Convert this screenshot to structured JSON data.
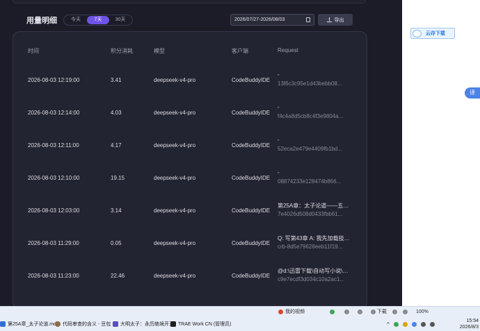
{
  "header": {
    "title": "用量明细",
    "tabs": [
      "今天",
      "7天",
      "30天"
    ],
    "active_tab": "7天"
  },
  "date_range": "2026/07/27-2026/08/03",
  "export_label": "导出",
  "table": {
    "columns": [
      "时间",
      "积分消耗",
      "模型",
      "客户端",
      "Request"
    ],
    "rows": [
      {
        "time": "2026-08-03 12:19:00",
        "credits": "3.41",
        "model": "deepseek-v4-pro",
        "client": "CodeBuddyIDE",
        "req_line1": "-",
        "req_line2": "13f6c3c95e1d43bebb08..."
      },
      {
        "time": "2026-08-03 12:14:00",
        "credits": "4.03",
        "model": "deepseek-v4-pro",
        "client": "CodeBuddyIDE",
        "req_line1": "-",
        "req_line2": "f4c4a8d5cb8c4f3e9804a..."
      },
      {
        "time": "2026-08-03 12:11:00",
        "credits": "4.17",
        "model": "deepseek-v4-pro",
        "client": "CodeBuddyIDE",
        "req_line1": "-",
        "req_line2": "52eca2e479e4409fb1bd..."
      },
      {
        "time": "2026-08-03 12:10:00",
        "credits": "19.15",
        "model": "deepseek-v4-pro",
        "client": "CodeBuddyIDE",
        "req_line1": "-",
        "req_line2": "08874233e128474b866..."
      },
      {
        "time": "2026-08-03 12:03:00",
        "credits": "3.14",
        "model": "deepseek-v4-pro",
        "client": "CodeBuddyIDE",
        "req_line1": "第25A章：太子论道——五大...",
        "req_line2": "7e4026d508d0433fbb61..."
      },
      {
        "time": "2026-08-03 11:29:00",
        "credits": "0.05",
        "model": "deepseek-v4-pro",
        "client": "CodeBuddyIDE",
        "req_line1": "Q: 写第43章 A: 我先加载技能...",
        "req_line2": "crb-8d5e79628eeb11f19..."
      },
      {
        "time": "2026-08-03 11:23:00",
        "credits": "22.46",
        "model": "deepseek-v4-pro",
        "client": "CodeBuddyIDE",
        "req_line1": "@d:\\迅雷下载\\自动写小说\\新...",
        "req_line2": "c9e7ecdf3d034c10a2ac1..."
      }
    ]
  },
  "overlay": {
    "cloud_download": "云存下载",
    "side_tab": "译"
  },
  "taskbar": {
    "items": [
      "第25A章_太子论道.md -",
      "代码审查的含义 - 豆包",
      "大明太子：永历绝境开天",
      "TRAE Work CN (管理员)"
    ],
    "tray": {
      "news": "我的视频",
      "download": "下载",
      "zoom": "100%"
    },
    "time": "15:54",
    "date": "2026/8/3"
  },
  "colors": {
    "background": "#1b1c27",
    "card": "#232431",
    "accent": "#6f52e8"
  }
}
